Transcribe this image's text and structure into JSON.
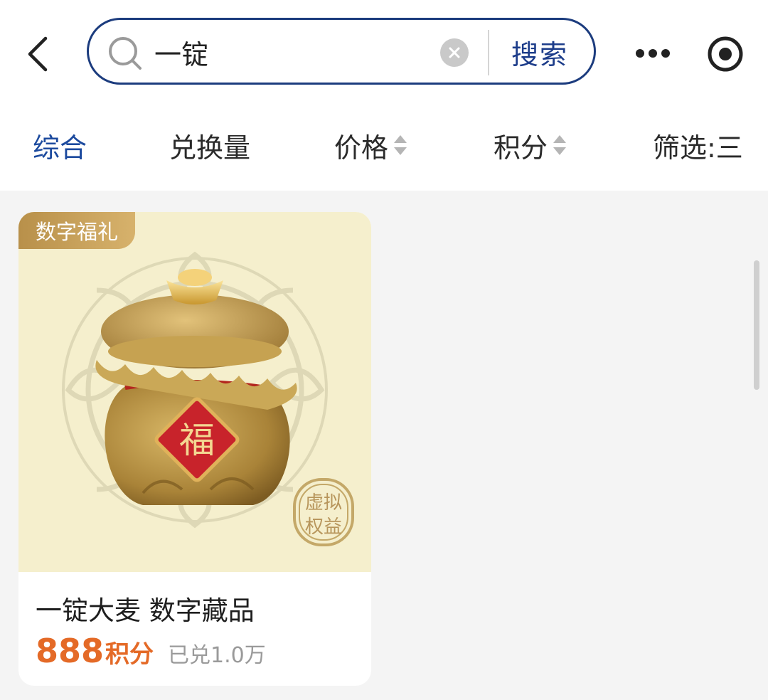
{
  "search": {
    "query": "一锭",
    "button_label": "搜索"
  },
  "tabs": [
    {
      "label": "综合",
      "active": true
    },
    {
      "label": "兑换量"
    },
    {
      "label": "价格",
      "sortable": true
    },
    {
      "label": "积分",
      "sortable": true
    },
    {
      "label": "筛选:三"
    }
  ],
  "icons": {
    "back": "back-arrow-icon",
    "search": "search-icon",
    "clear": "clear-icon",
    "more": "more-dots-icon",
    "target": "target-icon"
  },
  "colors": {
    "accent": "#1c3c8a",
    "price": "#e46a27",
    "card_bg": "#f5efcd",
    "badge": "#c9a35b"
  },
  "products": [
    {
      "badge": "数字福礼",
      "stamp_line1": "虚拟",
      "stamp_line2": "权益",
      "emblem": "福",
      "title": "一锭大麦 数字藏品",
      "price_value": "888",
      "price_unit": "积分",
      "redeemed": "已兑1.0万"
    }
  ]
}
